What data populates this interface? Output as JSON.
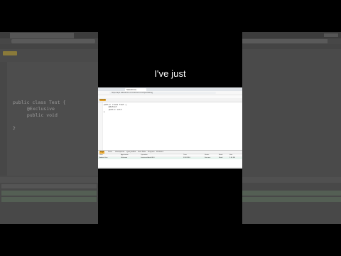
{
  "caption": "I've just",
  "side_left": {
    "code_lines": [
      "public class Test {",
      "  @Exclusive",
      "  public void",
      "}"
    ]
  },
  "browser": {
    "tab_title": "Salesforce",
    "url": "https://ap1.salesforce.com/ui/common/apex/debug",
    "run_button": "Execute",
    "code_lines": [
      "public class Test {",
      "    @IsTest",
      "    public void",
      "}"
    ],
    "panel_tabs": [
      "Logs",
      "Tests",
      "Checkpoints",
      "Query Editor",
      "View State",
      "Progress",
      "Problems"
    ],
    "log_rows": [
      [
        "User",
        "Application",
        "Operation",
        "Time",
        "Status",
        "Read",
        "Size"
      ],
      [
        "Admin User",
        "Unknown",
        "/services/data/v36.0",
        "5/10/2016",
        "Success",
        "Read",
        "2.06 KB"
      ]
    ]
  }
}
